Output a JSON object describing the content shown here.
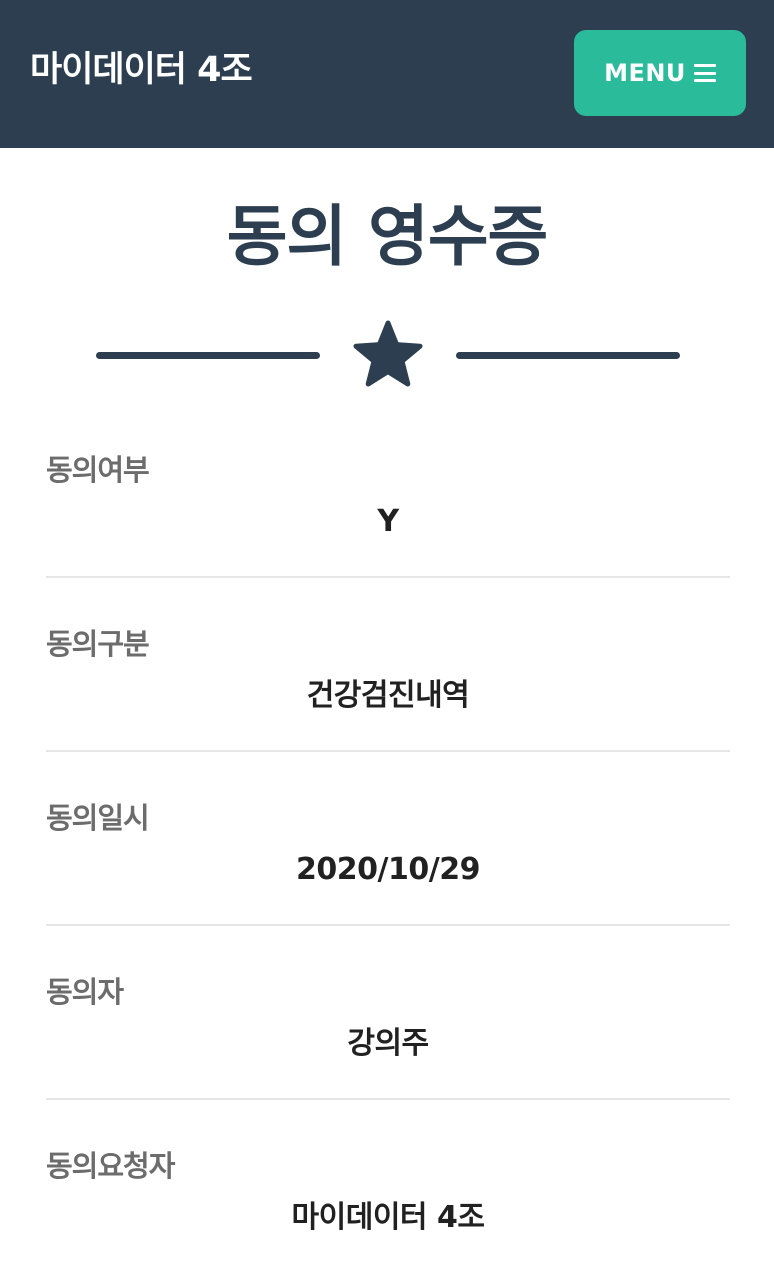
{
  "navbar": {
    "brand": "마이데이터 4조",
    "menu_label": "MENU",
    "menu_icon": "hamburger-icon"
  },
  "page": {
    "title": "동의 영수증",
    "divider_icon": "star-icon"
  },
  "fields": [
    {
      "label": "동의여부",
      "value": "Y"
    },
    {
      "label": "동의구분",
      "value": "건강검진내역"
    },
    {
      "label": "동의일시",
      "value": "2020/10/29"
    },
    {
      "label": "동의자",
      "value": "강의주"
    },
    {
      "label": "동의요청자",
      "value": "마이데이터 4조"
    }
  ],
  "colors": {
    "navbar_bg": "#2c3e50",
    "accent": "#2abb9b",
    "title": "#2c3e50",
    "label": "#6c6c6c",
    "value": "#212121",
    "rule": "#e6e6e6"
  }
}
